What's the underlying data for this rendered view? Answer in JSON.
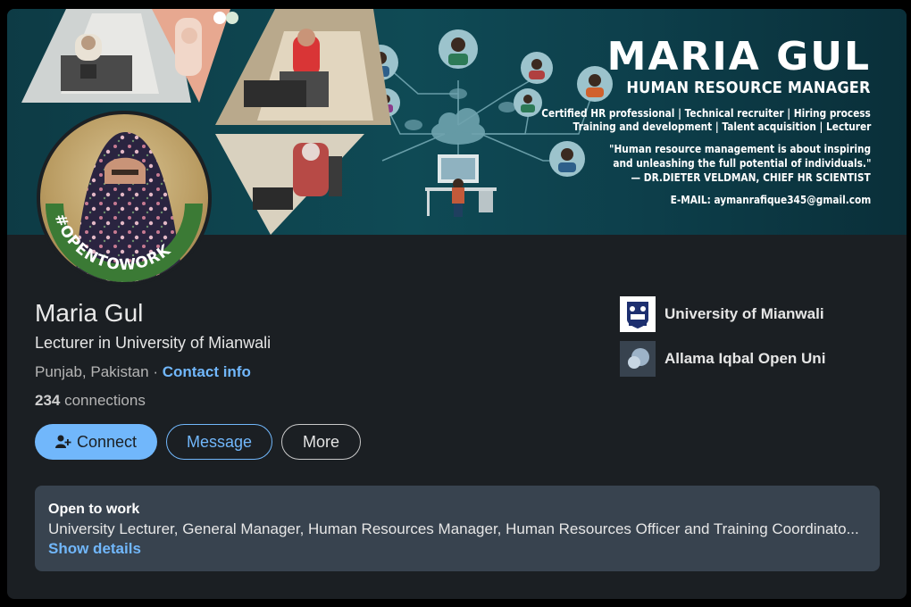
{
  "banner": {
    "title": "MARIA GUL",
    "subtitle": "HUMAN RESOURCE MANAGER",
    "line1": "Certified HR professional | Technical recruiter | Hiring process",
    "line2": "Training and development | Talent acquisition |  Lecturer",
    "quote1": "\"Human resource management is about inspiring",
    "quote2": "and unleashing the full potential of individuals.\"",
    "quote3": "— DR.DIETER VELDMAN, CHIEF HR SCIENTIST",
    "email": "E-MAIL: aymanrafique345@gmail.com"
  },
  "avatar": {
    "badge": "#OPENTOWORK"
  },
  "profile": {
    "name": "Maria Gul",
    "headline": "Lecturer in University of Mianwali",
    "location": "Punjab, Pakistan",
    "separator": " · ",
    "contact_info": "Contact info",
    "connections_count": "234",
    "connections_label": " connections"
  },
  "actions": {
    "connect": "Connect",
    "message": "Message",
    "more": "More"
  },
  "education": [
    {
      "name": "University of Mianwali",
      "logo": "university-logo"
    },
    {
      "name": "Allama Iqbal Open Uni",
      "logo": "school-placeholder-logo"
    }
  ],
  "open_to_work": {
    "title": "Open to work",
    "roles": "University Lecturer, General Manager, Human Resources Manager, Human Resources Officer and Training Coordinato...",
    "link": "Show details"
  },
  "colors": {
    "accent": "#71b7fb",
    "card_bg": "#1b1f23",
    "otw_bg": "#38434f",
    "badge_green": "#3b7a35"
  }
}
